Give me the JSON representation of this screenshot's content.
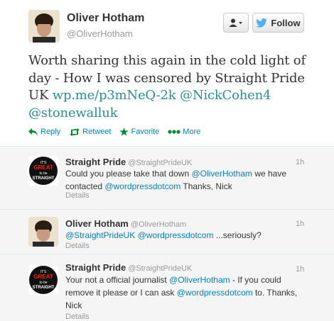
{
  "main_tweet": {
    "name": "Oliver Hotham",
    "handle": "@OliverHotham",
    "text_parts": [
      "Worth sharing this again in the cold light of day - How I was censored by Straight Pride UK ",
      "wp.me/p3mNeQ-2k",
      " ",
      "@NickCohen4",
      " ",
      "@stonewalluk"
    ],
    "follow_label": "Follow",
    "actions": {
      "reply": "Reply",
      "retweet": "Retweet",
      "favorite": "Favorite",
      "more": "More"
    }
  },
  "replies": [
    {
      "name": "Straight Pride",
      "handle": "@StraightPrideUK",
      "time": "1h",
      "text_parts": [
        "Could you please take that down ",
        "@OliverHotham",
        " we have contacted ",
        "@wordpressdotcom",
        " Thanks, Nick"
      ],
      "details": "Details",
      "avatar_text": [
        "IT'S",
        "GREAT",
        "to be",
        "STRAIGHT"
      ]
    },
    {
      "name": "Oliver Hotham",
      "handle": "@OliverHotham",
      "time": "1h",
      "text_parts": [
        "@StraightPrideUK",
        " ",
        "@wordpressdotcom",
        " ...seriously?"
      ],
      "details": "Details"
    },
    {
      "name": "Straight Pride",
      "handle": "@StraightPrideUK",
      "time": "1h",
      "text_parts": [
        "Your not a official journalist ",
        "@OliverHotham",
        " - If you could remove it please or I can ask ",
        "@wordpressdotcom",
        " to. Thanks, Nick"
      ],
      "details": "Details",
      "avatar_text": [
        "IT'S",
        "GREAT",
        "to be",
        "STRAIGHT"
      ]
    }
  ],
  "colors": {
    "link": "#0084b4",
    "serif_link": "#2a8f8f",
    "twitter_blue": "#55acee"
  }
}
